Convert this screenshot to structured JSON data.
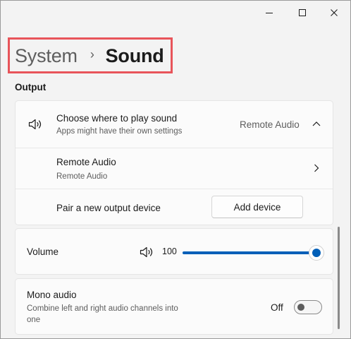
{
  "window": {
    "caption_buttons": [
      "minimize-icon",
      "maximize-icon",
      "close-icon"
    ]
  },
  "breadcrumb": {
    "parent": "System",
    "separator": "›",
    "current": "Sound"
  },
  "output": {
    "section_title": "Output",
    "choose_device": {
      "icon": "speaker-icon",
      "title": "Choose where to play sound",
      "subtitle": "Apps might have their own settings",
      "selected_value": "Remote Audio",
      "expander_icon": "chevron-up-icon"
    },
    "device": {
      "title": "Remote Audio",
      "subtitle": "Remote Audio",
      "chevron_icon": "chevron-right-icon"
    },
    "pair": {
      "label": "Pair a new output device",
      "button_label": "Add device"
    }
  },
  "volume": {
    "label": "Volume",
    "icon": "speaker-icon",
    "value_text": "100",
    "level": 100
  },
  "mono_audio": {
    "title": "Mono audio",
    "subtitle_line1": "Combine left and right audio channels into",
    "subtitle_line2": "one",
    "state_label": "Off",
    "enabled": false
  },
  "colors": {
    "accent": "#005fb8",
    "highlight_box": "#e8545a",
    "background": "#f3f3f3",
    "card": "#fbfbfb"
  }
}
